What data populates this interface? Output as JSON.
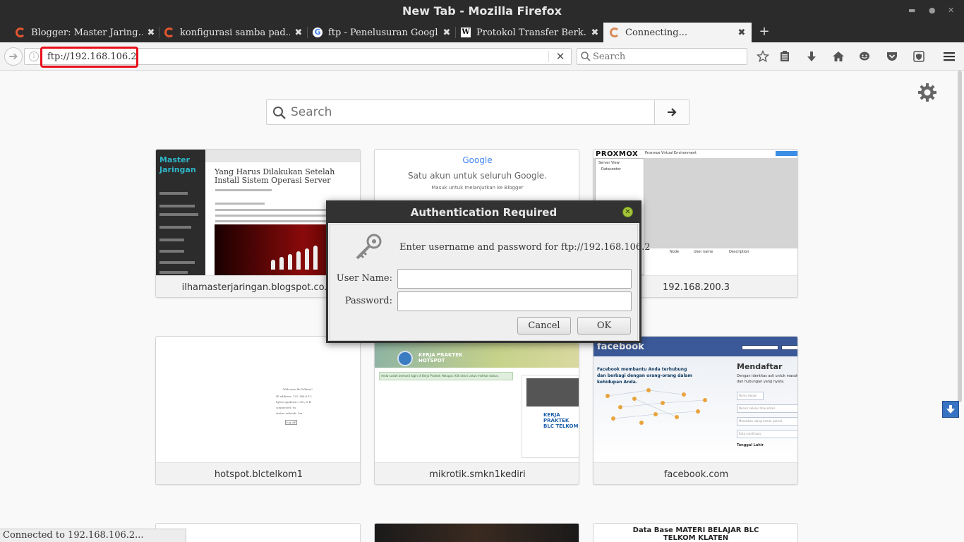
{
  "window": {
    "title": "New Tab - Mozilla Firefox"
  },
  "tabs": [
    {
      "label": "Blogger: Master Jaring...",
      "icon": "blogger-loading-icon",
      "active": false
    },
    {
      "label": "konfigurasi samba pad...",
      "icon": "blogger-loading-icon",
      "active": false
    },
    {
      "label": "ftp - Penelusuran Google",
      "icon": "google-icon",
      "active": false
    },
    {
      "label": "Protokol Transfer Berk...",
      "icon": "wikipedia-icon",
      "active": false
    },
    {
      "label": "Connecting...",
      "icon": "loading-spinner-icon",
      "active": true
    }
  ],
  "navbar": {
    "url": "ftp://192.168.106.2",
    "search_placeholder": "Search"
  },
  "content": {
    "search_placeholder": "Search",
    "tiles": [
      {
        "caption": "ilhamasterjaringan.blogspot.co.id"
      },
      {
        "caption": ""
      },
      {
        "caption": "192.168.200.3"
      },
      {
        "caption": "hotspot.blctelkom1"
      },
      {
        "caption": "mikrotik.smkn1kediri"
      },
      {
        "caption": "facebook.com"
      }
    ],
    "thumbs": {
      "blog_logo": "Master Jaringan",
      "blog_post_title": "Yang Harus Dilakukan Setelah Install Sistem Operasi Server",
      "google_logo": "Google",
      "google_text": "Satu akun untuk seluruh Google.",
      "google_sub": "Masuk untuk melanjutkan ke Blogger",
      "proxmox_logo": "PROXMOX",
      "proxmox_title": "Proxmox Virtual Environment",
      "proxmox_view": "Server View",
      "proxmox_dc": "Datacenter",
      "proxmox_cols": [
        "Node",
        "User name",
        "Description"
      ],
      "hotspot_lines": [
        "Welcome blcTelkom!",
        "IP address: 192.168.8.12",
        "bytes up/down: 0 B / 0 B",
        "connected: 0s",
        "status refresh: 1m",
        "log off"
      ],
      "mikrotik_head": "KERJA PRAKTEK HOTSPOT",
      "mikrotik_note": "Anda sudah berhasil login di Kerja Praktek Hotspot. Klik disini untuk melihat status.",
      "mikrotik_card": "KERJA PRAKTEK BLC TELKOM",
      "fb_logo": "facebook",
      "fb_text": "Facebook membantu Anda terhubung dan berbagi dengan orang-orang dalam kehidupan Anda.",
      "fb_reg": "Mendaftar",
      "fb_reg_sub": "Dengan identitas asli untuk masuk dan hubungan yang nyata.",
      "fb_fields": [
        "Nama depan",
        "Nomor seluler atau email",
        "Masukkan ulang nomor ponsel",
        "Kata sandi baru"
      ],
      "fb_birth": "Tanggal Lahir"
    },
    "partial_tile_text": "Data Base MATERI BELAJAR BLC TELKOM KLATEN"
  },
  "dialog": {
    "title": "Authentication Required",
    "message": "Enter username and password for ftp://192.168.106.2",
    "username_label": "User Name:",
    "password_label": "Password:",
    "username_value": "",
    "password_value": "",
    "cancel_label": "Cancel",
    "ok_label": "OK"
  },
  "statusbar": {
    "text": "Connected to 192.168.106.2..."
  },
  "colors": {
    "chrome_dark": "#2b2b2b",
    "highlight_red": "#e8101b",
    "facebook_blue": "#3b5998",
    "dialog_close_green": "#a4c639"
  }
}
